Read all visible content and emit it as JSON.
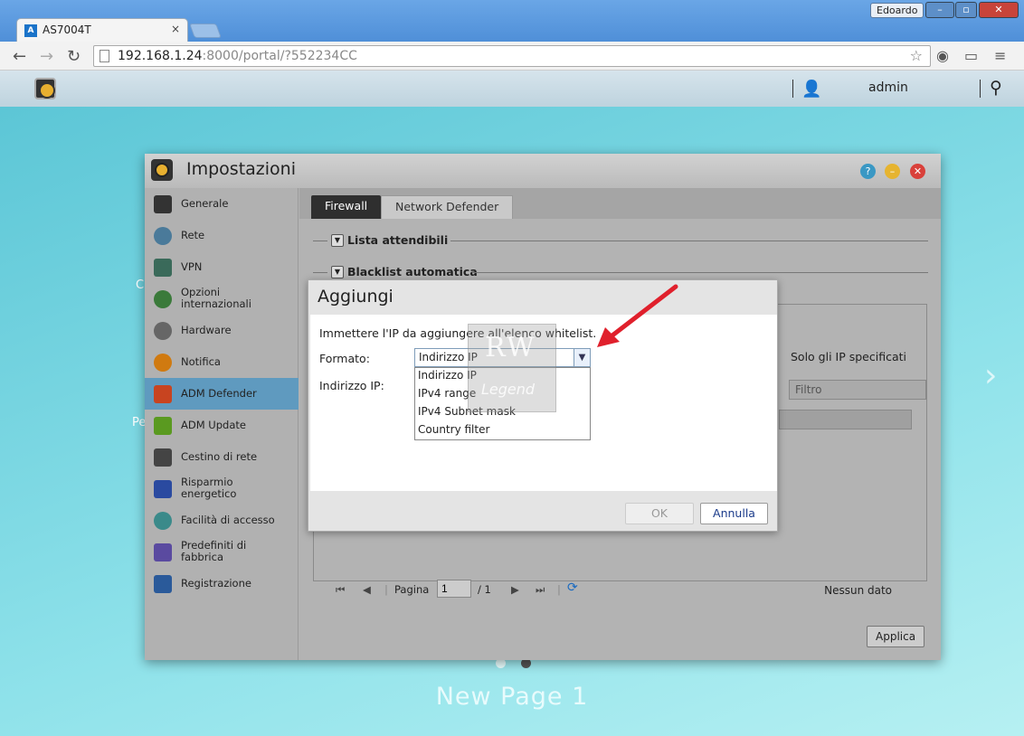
{
  "browser": {
    "tab_title": "AS7004T",
    "tab_close": "×",
    "user_badge": "Edoardo",
    "url_host": "192.168.1.24",
    "url_rest": ":8000/portal/?552234CC"
  },
  "adm": {
    "username": "admin"
  },
  "desktop": {
    "caption": "New Page 1",
    "edge_text_1": "C",
    "edge_text_2": "Pe"
  },
  "settings": {
    "title": "Impostazioni",
    "sidebar": [
      {
        "label": "Generale",
        "icon": "server-icon"
      },
      {
        "label": "Rete",
        "icon": "globe-icon"
      },
      {
        "label": "VPN",
        "icon": "vpn-house-icon"
      },
      {
        "label": "Opzioni internazionali",
        "icon": "globe-pin-icon"
      },
      {
        "label": "Hardware",
        "icon": "hardware-icon"
      },
      {
        "label": "Notifica",
        "icon": "warning-icon"
      },
      {
        "label": "ADM Defender",
        "icon": "firewall-icon"
      },
      {
        "label": "ADM Update",
        "icon": "update-arrow-icon"
      },
      {
        "label": "Cestino di rete",
        "icon": "trash-icon"
      },
      {
        "label": "Risparmio energetico",
        "icon": "energy-icon"
      },
      {
        "label": "Facilità di accesso",
        "icon": "cloud-upload-icon"
      },
      {
        "label": "Predefiniti di fabbrica",
        "icon": "reset-arrow-icon"
      },
      {
        "label": "Registrazione",
        "icon": "log-icon"
      }
    ],
    "active_item": "ADM Defender",
    "tabs": {
      "firewall": "Firewall",
      "network_defender": "Network Defender"
    },
    "sections": {
      "trusted": "Lista attendibili",
      "auto_blacklist": "Blacklist automatica"
    },
    "solo_text": "Solo gli IP specificati",
    "filter_placeholder": "Filtro",
    "pager": {
      "page_label": "Pagina",
      "page_value": "1",
      "page_total": "/ 1",
      "no_data": "Nessun dato"
    },
    "apply_label": "Applica"
  },
  "dialog": {
    "title": "Aggiungi",
    "instructions": "Immettere l'IP da aggiungere all'elenco whitelist.",
    "format_label": "Formato:",
    "ip_label": "Indirizzo IP:",
    "format_value": "Indirizzo IP",
    "options": [
      "Indirizzo IP",
      "IPv4 range",
      "IPv4 Subnet mask",
      "Country filter"
    ],
    "ok_label": "OK",
    "cancel_label": "Annulla",
    "watermark_top": "RW",
    "watermark_bottom": "Legend"
  },
  "colors": {
    "active_sidebar": "#5f9abf",
    "annotation_arrow": "#e0202c"
  }
}
